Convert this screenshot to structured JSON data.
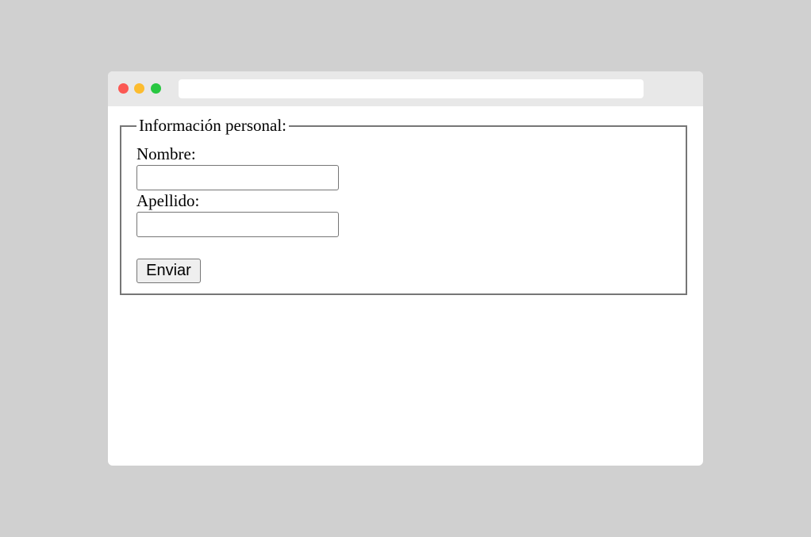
{
  "window": {
    "controls": {
      "close_color": "#fb5853",
      "minimize_color": "#fcbc2f",
      "maximize_color": "#28c741"
    },
    "address_bar": {
      "value": ""
    }
  },
  "form": {
    "legend": "Información personal:",
    "fields": [
      {
        "label": "Nombre:",
        "value": ""
      },
      {
        "label": "Apellido:",
        "value": ""
      }
    ],
    "submit_label": "Enviar"
  }
}
